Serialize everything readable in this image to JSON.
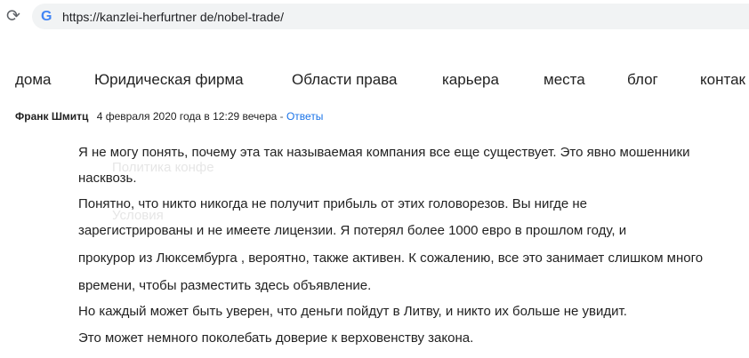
{
  "browser": {
    "url": "https://kanzlei-herfurtner de/nobel-trade/",
    "reload_glyph": "⟳",
    "site_icon": "G"
  },
  "nav": {
    "items": [
      "дома",
      "Юридическая фирма",
      "Области права",
      "карьера",
      "места",
      "блог",
      "контак"
    ]
  },
  "ghost_text": [
    "Политика конфе",
    "Условия"
  ],
  "comment": {
    "author": "Франк Шмитц",
    "date": "4 февраля 2020 года в 12:29 вечера",
    "separator": " - ",
    "reply_label": "Ответы",
    "lines": [
      "Я не могу понять, почему эта так называемая компания все еще существует. Это явно мошенники",
      "насквозь.",
      "Понятно, что никто никогда не получит прибыль от этих головорезов. Вы нигде не",
      "зарегистрированы и не имеете лицензии. Я потерял более 1000 евро в прошлом году, и",
      "прокурор из Люксембурга , вероятно, также активен. К сожалению, все это занимает слишком много",
      "времени, чтобы разместить здесь объявление.",
      "Но каждый может быть уверен, что деньги пойдут в Литву, и никто их больше не увидит.",
      "Это может немного поколебать доверие к верховенству закона."
    ]
  },
  "colors": {
    "link": "#1a73e8",
    "omnibox_bg": "#f1f3f4",
    "ghost": "#e6e6e6"
  }
}
